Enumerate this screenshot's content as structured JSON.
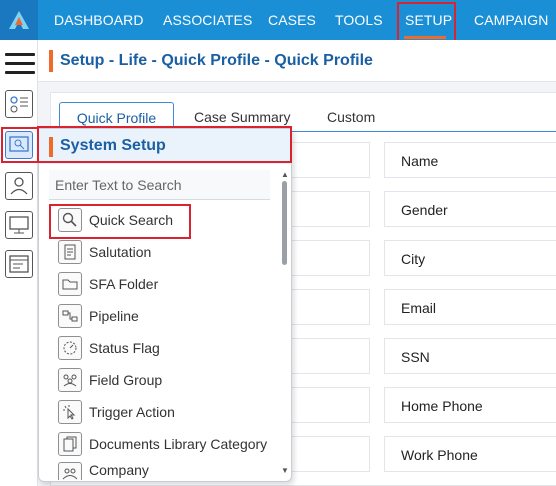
{
  "nav": {
    "items": [
      {
        "label": "DASHBOARD"
      },
      {
        "label": "ASSOCIATES"
      },
      {
        "label": "CASES"
      },
      {
        "label": "TOOLS"
      },
      {
        "label": "SETUP"
      },
      {
        "label": "CAMPAIGN"
      }
    ],
    "active": "SETUP"
  },
  "breadcrumb": {
    "title": "Setup - Life - Quick Profile - Quick Profile"
  },
  "tabs": [
    {
      "label": "Quick Profile",
      "active": true
    },
    {
      "label": "Case Summary",
      "active": false
    },
    {
      "label": "Custom",
      "active": false
    }
  ],
  "fields": [
    {
      "label": "Name"
    },
    {
      "label": "Gender"
    },
    {
      "label": "City"
    },
    {
      "label": "Email"
    },
    {
      "label": "SSN"
    },
    {
      "label": "Home Phone"
    },
    {
      "label": "Work Phone"
    }
  ],
  "panel": {
    "title": "System Setup",
    "search_placeholder": "Enter Text to Search",
    "items": [
      {
        "label": "Quick Search",
        "icon": "magnifier-icon"
      },
      {
        "label": "Salutation",
        "icon": "document-icon"
      },
      {
        "label": "SFA Folder",
        "icon": "folder-icon"
      },
      {
        "label": "Pipeline",
        "icon": "pipeline-icon"
      },
      {
        "label": "Status Flag",
        "icon": "status-circle-icon"
      },
      {
        "label": "Field Group",
        "icon": "group-icon"
      },
      {
        "label": "Trigger Action",
        "icon": "pointer-click-icon"
      },
      {
        "label": "Documents Library Category",
        "icon": "documents-icon"
      },
      {
        "label": "Company",
        "icon": "company-icon"
      }
    ]
  },
  "colors": {
    "nav_blue": "#1a8fd6",
    "accent_orange": "#f06a2b",
    "title_blue": "#1b5fa3",
    "highlight_red": "#d9232e"
  }
}
